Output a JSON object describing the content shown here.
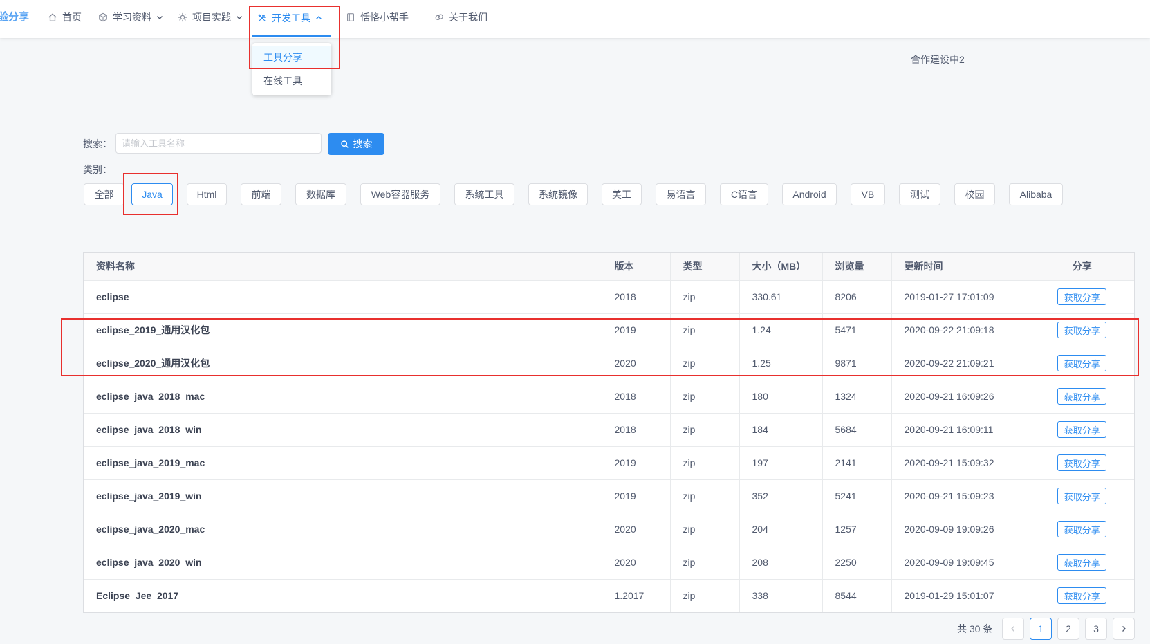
{
  "theme": {
    "primary": "#2d8cf0",
    "annotation": "#e8302e",
    "text": "#515a6e",
    "page_background": "#f5f7f9",
    "logo": "#57a3f3"
  },
  "brand": {
    "logo_text": "验分享"
  },
  "nav": {
    "items": [
      {
        "label": "首页",
        "icon": "home-icon",
        "active": false
      },
      {
        "label": "学习资料",
        "icon": "cube-icon",
        "has_dropdown": true,
        "active": false
      },
      {
        "label": "项目实践",
        "icon": "gear-icon",
        "has_dropdown": true,
        "active": false
      },
      {
        "label": "开发工具",
        "icon": "tools-icon",
        "has_dropdown": true,
        "active": true,
        "expanded": true
      },
      {
        "label": "恬恪小帮手",
        "icon": "book-icon",
        "active": false
      },
      {
        "label": "关于我们",
        "icon": "chat-icon",
        "active": false
      }
    ],
    "dropdown": {
      "items": [
        {
          "label": "工具分享",
          "active": true
        },
        {
          "label": "在线工具",
          "active": false
        }
      ]
    }
  },
  "notice": "合作建设中2",
  "search": {
    "label": "搜索：",
    "placeholder": "请输入工具名称",
    "value": "",
    "button_label": "搜索",
    "button_icon": "search-icon"
  },
  "categories": {
    "label": "类别：",
    "items": [
      {
        "label": "全部",
        "selected": false
      },
      {
        "label": "Java",
        "selected": true
      },
      {
        "label": "Html",
        "selected": false
      },
      {
        "label": "前端",
        "selected": false
      },
      {
        "label": "数据库",
        "selected": false
      },
      {
        "label": "Web容器服务",
        "selected": false
      },
      {
        "label": "系统工具",
        "selected": false
      },
      {
        "label": "系统镜像",
        "selected": false
      },
      {
        "label": "美工",
        "selected": false
      },
      {
        "label": "易语言",
        "selected": false
      },
      {
        "label": "C语言",
        "selected": false
      },
      {
        "label": "Android",
        "selected": false
      },
      {
        "label": "VB",
        "selected": false
      },
      {
        "label": "测试",
        "selected": false
      },
      {
        "label": "校园",
        "selected": false
      },
      {
        "label": "Alibaba",
        "selected": false
      }
    ]
  },
  "table": {
    "columns": [
      "资料名称",
      "版本",
      "类型",
      "大小（MB）",
      "浏览量",
      "更新时间",
      "分享"
    ],
    "action_label": "获取分享",
    "rows": [
      {
        "name": "eclipse",
        "version": "2018",
        "type": "zip",
        "size": "330.61",
        "views": "8206",
        "updated": "2019-01-27 17:01:09"
      },
      {
        "name": "eclipse_2019_通用汉化包",
        "version": "2019",
        "type": "zip",
        "size": "1.24",
        "views": "5471",
        "updated": "2020-09-22 21:09:18"
      },
      {
        "name": "eclipse_2020_通用汉化包",
        "version": "2020",
        "type": "zip",
        "size": "1.25",
        "views": "9871",
        "updated": "2020-09-22 21:09:21"
      },
      {
        "name": "eclipse_java_2018_mac",
        "version": "2018",
        "type": "zip",
        "size": "180",
        "views": "1324",
        "updated": "2020-09-21 16:09:26"
      },
      {
        "name": "eclipse_java_2018_win",
        "version": "2018",
        "type": "zip",
        "size": "184",
        "views": "5684",
        "updated": "2020-09-21 16:09:11"
      },
      {
        "name": "eclipse_java_2019_mac",
        "version": "2019",
        "type": "zip",
        "size": "197",
        "views": "2141",
        "updated": "2020-09-21 15:09:32"
      },
      {
        "name": "eclipse_java_2019_win",
        "version": "2019",
        "type": "zip",
        "size": "352",
        "views": "5241",
        "updated": "2020-09-21 15:09:23"
      },
      {
        "name": "eclipse_java_2020_mac",
        "version": "2020",
        "type": "zip",
        "size": "204",
        "views": "1257",
        "updated": "2020-09-09 19:09:26"
      },
      {
        "name": "eclipse_java_2020_win",
        "version": "2020",
        "type": "zip",
        "size": "208",
        "views": "2250",
        "updated": "2020-09-09 19:09:45"
      },
      {
        "name": "Eclipse_Jee_2017",
        "version": "1.2017",
        "type": "zip",
        "size": "338",
        "views": "8544",
        "updated": "2019-01-29 15:01:07"
      }
    ]
  },
  "pagination": {
    "total_text": "共 30 条",
    "prev_disabled": true,
    "prev_icon": "chevron-left-icon",
    "next_icon": "chevron-right-icon",
    "pages": [
      {
        "label": "1",
        "current": true
      },
      {
        "label": "2",
        "current": false
      },
      {
        "label": "3",
        "current": false
      }
    ]
  }
}
